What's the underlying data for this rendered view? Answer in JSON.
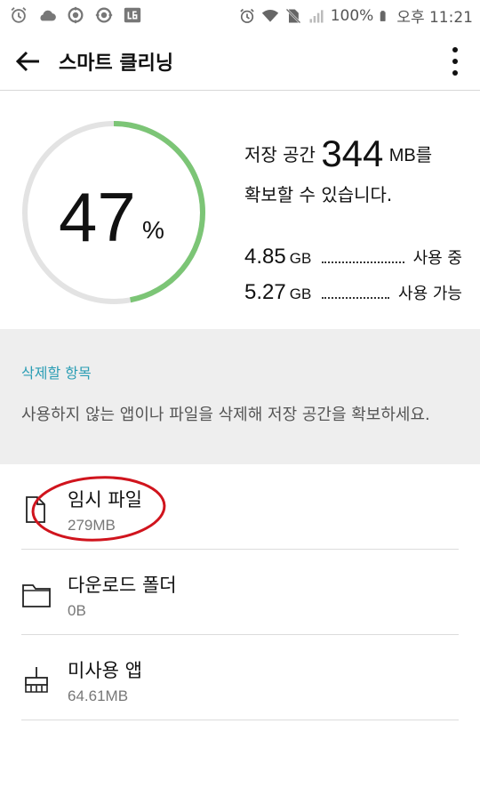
{
  "status_bar": {
    "battery": "100%",
    "time": "오후 11:21",
    "left_icons": [
      "alarm-icon",
      "cloud-icon",
      "sync-icon",
      "sync-icon",
      "lg-icon"
    ],
    "right_icons": [
      "alarm-icon",
      "wifi-icon",
      "no-sim-icon",
      "signal-icon",
      "battery-icon"
    ]
  },
  "app_bar": {
    "title": "스마트 클리닝",
    "back_icon": "back-arrow-icon",
    "menu_icon": "more-vert-icon"
  },
  "storage": {
    "percent": "47",
    "percent_sign": "%",
    "percent_value": 47,
    "free_prefix": "저장 공간",
    "free_amount": "344",
    "free_unit": "MB를",
    "free_suffix": "확보할 수 있습니다.",
    "used_value": "4.85",
    "used_unit": "GB",
    "used_label": "사용 중",
    "available_value": "5.27",
    "available_unit": "GB",
    "available_label": "사용 가능",
    "ring_color": "#7cc576",
    "ring_track_color": "#e3e3e3"
  },
  "section": {
    "title": "삭제할 항목",
    "description": "사용하지 않는 앱이나 파일을 삭제해 저장 공간을 확보하세요.",
    "accent_color": "#2a9db4"
  },
  "items": [
    {
      "name": "임시 파일",
      "size": "279MB",
      "icon": "file-icon"
    },
    {
      "name": "다운로드 폴더",
      "size": "0B",
      "icon": "folder-icon"
    },
    {
      "name": "미사용 앱",
      "size": "64.61MB",
      "icon": "broom-icon"
    }
  ]
}
